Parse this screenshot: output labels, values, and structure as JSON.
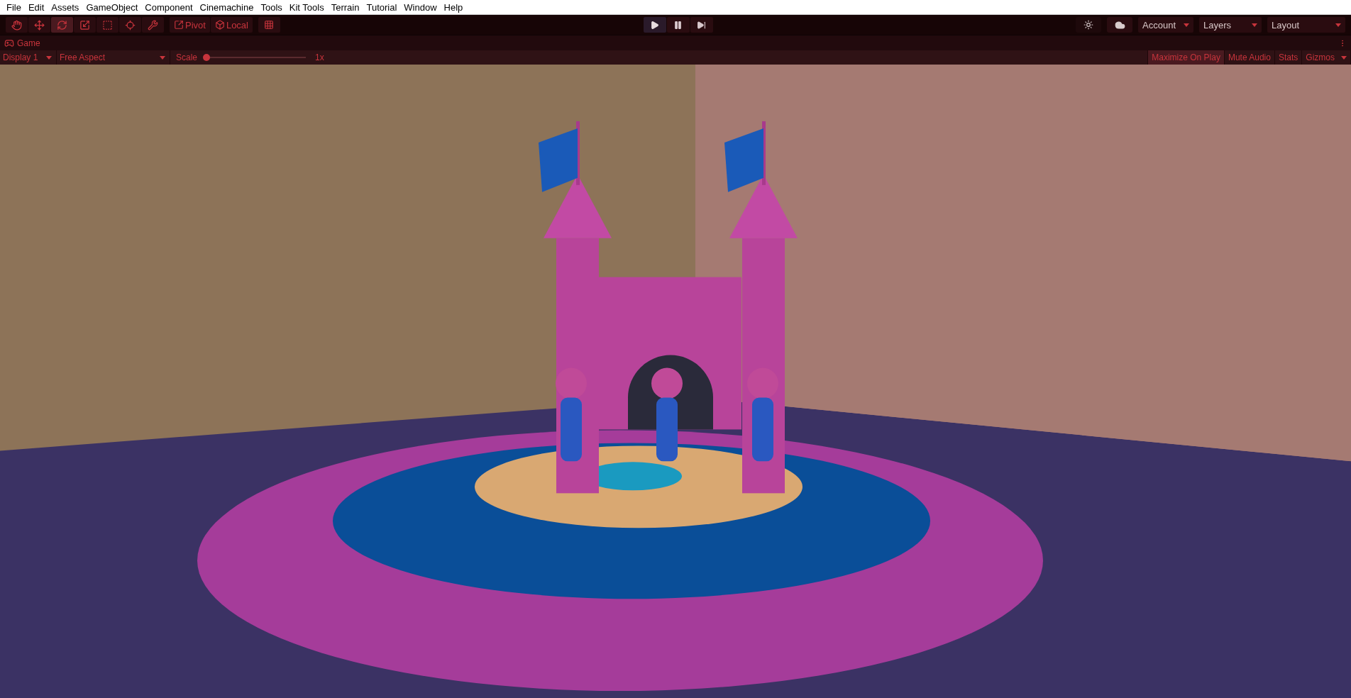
{
  "menu": [
    "File",
    "Edit",
    "Assets",
    "GameObject",
    "Component",
    "Cinemachine",
    "Tools",
    "Kit Tools",
    "Terrain",
    "Tutorial",
    "Window",
    "Help"
  ],
  "tools": [
    {
      "kind": "hand",
      "selected": false
    },
    {
      "kind": "move",
      "selected": false
    },
    {
      "kind": "rotate",
      "selected": true
    },
    {
      "kind": "scale",
      "selected": false
    },
    {
      "kind": "rect",
      "selected": false
    },
    {
      "kind": "transform",
      "selected": false
    },
    {
      "kind": "custom",
      "selected": false
    }
  ],
  "handle_buttons": [
    {
      "kind": "pivot",
      "label": "Pivot"
    },
    {
      "kind": "local",
      "label": "Local"
    }
  ],
  "play_controls": [
    {
      "kind": "play",
      "selected": true
    },
    {
      "kind": "pause",
      "selected": false
    },
    {
      "kind": "step",
      "selected": false
    }
  ],
  "dropdowns": [
    "Account",
    "Layers",
    "Layout"
  ],
  "game_tab": {
    "label": "Game"
  },
  "game_toolbar": {
    "display": "Display 1",
    "aspect": "Free Aspect",
    "scale_label": "Scale",
    "scale": {
      "level": 0.0
    },
    "scale_reading": "1x",
    "toggles": [
      {
        "label": "Maximize On Play",
        "on": true
      },
      {
        "label": "Mute Audio",
        "on": false
      },
      {
        "label": "Stats",
        "on": false
      },
      {
        "label": "Gizmos",
        "on": false
      }
    ]
  }
}
